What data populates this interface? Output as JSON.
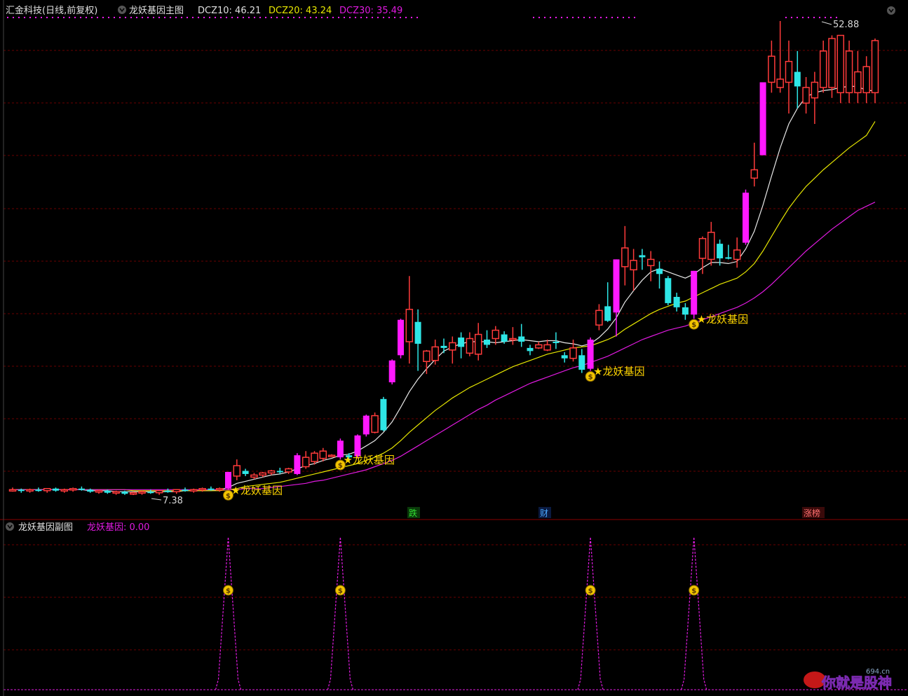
{
  "main_panel": {
    "title": "汇金科技(日线,前复权)",
    "indicator_name": "龙妖基因主图",
    "dcz10_label": "DCZ10: 46.21",
    "dcz20_label": "DCZ20: 43.24",
    "dcz30_label": "DCZ30: 35.49",
    "high_label": "52.88",
    "low_label": "7.38",
    "signal_label": "★龙妖基因",
    "event_tags": [
      "跌",
      "财",
      "涨榜"
    ]
  },
  "sub_panel": {
    "title": "龙妖基因副图",
    "value_label": "龙妖基因: 0.00"
  },
  "watermark": {
    "text": "你就是股神",
    "domain": "694.cn"
  },
  "colors": {
    "background": "#000000",
    "up": "#ff3b3b",
    "down": "#2ee6e6",
    "strong": "#ff19ff",
    "dcz10": "#e8e8e8",
    "dcz20": "#e6e600",
    "dcz30": "#e01ae0",
    "grid": "#6a0000",
    "signal_text": "#ffd500"
  },
  "chart_data": {
    "type": "candlestick",
    "ylim": [
      5,
      55
    ],
    "x": [
      0,
      1,
      2,
      3,
      4,
      5,
      6,
      7,
      8,
      9,
      10,
      11,
      12,
      13,
      14,
      15,
      16,
      17,
      18,
      19,
      20,
      21,
      22,
      23,
      24,
      25,
      26,
      27,
      28,
      29,
      30,
      31,
      32,
      33,
      34,
      35,
      36,
      37,
      38,
      39,
      40,
      41,
      42,
      43,
      44,
      45,
      46,
      47,
      48,
      49,
      50,
      51,
      52,
      53,
      54,
      55,
      56,
      57,
      58,
      59,
      60,
      61,
      62,
      63,
      64,
      65,
      66,
      67,
      68,
      69,
      70,
      71,
      72,
      73,
      74,
      75,
      76,
      77,
      78,
      79,
      80,
      81,
      82,
      83,
      84,
      85,
      86,
      87,
      88,
      89,
      90,
      91,
      92,
      93,
      94,
      95,
      96,
      97,
      98,
      99,
      100
    ],
    "candles": [
      [
        7.9,
        8.1,
        7.7,
        7.9,
        "u"
      ],
      [
        7.9,
        8.0,
        7.6,
        7.8,
        "d"
      ],
      [
        7.8,
        8.0,
        7.6,
        7.9,
        "u"
      ],
      [
        7.9,
        8.1,
        7.7,
        7.8,
        "d"
      ],
      [
        7.8,
        8.0,
        7.6,
        8.0,
        "u"
      ],
      [
        8.0,
        8.1,
        7.7,
        7.8,
        "d"
      ],
      [
        7.8,
        8.0,
        7.6,
        7.9,
        "u"
      ],
      [
        7.9,
        8.1,
        7.7,
        8.0,
        "u"
      ],
      [
        8.0,
        8.2,
        7.8,
        7.9,
        "d"
      ],
      [
        7.9,
        8.0,
        7.6,
        7.7,
        "d"
      ],
      [
        7.7,
        7.9,
        7.5,
        7.8,
        "u"
      ],
      [
        7.8,
        7.9,
        7.5,
        7.6,
        "d"
      ],
      [
        7.6,
        7.8,
        7.4,
        7.7,
        "u"
      ],
      [
        7.7,
        7.8,
        7.4,
        7.5,
        "d"
      ],
      [
        7.5,
        7.7,
        7.38,
        7.6,
        "u"
      ],
      [
        7.6,
        7.8,
        7.4,
        7.7,
        "u"
      ],
      [
        7.7,
        7.9,
        7.5,
        7.6,
        "d"
      ],
      [
        7.6,
        7.8,
        7.4,
        7.8,
        "u"
      ],
      [
        7.8,
        8.0,
        7.6,
        7.7,
        "d"
      ],
      [
        7.7,
        7.9,
        7.5,
        7.9,
        "u"
      ],
      [
        7.9,
        8.1,
        7.7,
        7.8,
        "d"
      ],
      [
        7.8,
        8.0,
        7.6,
        7.9,
        "u"
      ],
      [
        7.9,
        8.1,
        7.7,
        8.0,
        "u"
      ],
      [
        8.0,
        8.2,
        7.8,
        7.9,
        "d"
      ],
      [
        7.9,
        8.1,
        7.7,
        8.0,
        "u"
      ],
      [
        8.0,
        9.6,
        7.9,
        9.6,
        "s"
      ],
      [
        9.2,
        10.8,
        8.8,
        10.2,
        "u"
      ],
      [
        9.7,
        9.9,
        9.2,
        9.4,
        "d"
      ],
      [
        9.1,
        9.5,
        8.9,
        9.3,
        "u"
      ],
      [
        9.3,
        9.6,
        9.1,
        9.5,
        "u"
      ],
      [
        9.5,
        9.8,
        9.3,
        9.7,
        "u"
      ],
      [
        9.7,
        10.0,
        9.4,
        9.6,
        "d"
      ],
      [
        9.6,
        10.0,
        9.4,
        9.9,
        "u"
      ],
      [
        9.4,
        11.4,
        9.3,
        11.2,
        "s"
      ],
      [
        10.1,
        11.6,
        9.9,
        11.0,
        "u"
      ],
      [
        10.6,
        11.6,
        10.3,
        11.4,
        "u"
      ],
      [
        10.9,
        11.9,
        10.6,
        11.6,
        "u"
      ],
      [
        11.1,
        11.3,
        11.0,
        11.2,
        "u"
      ],
      [
        11.0,
        12.8,
        10.8,
        12.6,
        "s"
      ],
      [
        11.2,
        11.4,
        10.8,
        11.0,
        "d"
      ],
      [
        11.1,
        13.2,
        10.9,
        13.1,
        "s"
      ],
      [
        13.2,
        15.1,
        13.0,
        15.0,
        "s"
      ],
      [
        13.4,
        15.3,
        13.3,
        15.0,
        "u"
      ],
      [
        13.6,
        16.8,
        13.5,
        16.6,
        "d"
      ],
      [
        18.2,
        20.4,
        18.0,
        20.3,
        "s"
      ],
      [
        20.8,
        24.3,
        20.5,
        24.2,
        "s"
      ],
      [
        22.1,
        28.4,
        20.0,
        25.2,
        "u"
      ],
      [
        24.0,
        25.2,
        19.3,
        21.9,
        "d"
      ],
      [
        20.2,
        21.3,
        19.0,
        21.2,
        "u"
      ],
      [
        20.3,
        22.3,
        19.9,
        21.6,
        "u"
      ],
      [
        21.5,
        22.4,
        21.0,
        21.7,
        "d"
      ],
      [
        21.3,
        22.6,
        20.0,
        22.0,
        "u"
      ],
      [
        21.6,
        23.0,
        20.5,
        22.5,
        "d"
      ],
      [
        21.0,
        23.0,
        20.7,
        22.4,
        "u"
      ],
      [
        20.9,
        23.9,
        20.3,
        22.8,
        "u"
      ],
      [
        21.8,
        23.2,
        21.5,
        22.3,
        "d"
      ],
      [
        22.4,
        23.6,
        21.8,
        23.2,
        "u"
      ],
      [
        22.8,
        23.1,
        21.9,
        22.1,
        "d"
      ],
      [
        22.3,
        23.5,
        21.8,
        22.4,
        "u"
      ],
      [
        22.1,
        23.8,
        21.6,
        22.6,
        "d"
      ],
      [
        21.5,
        21.8,
        20.8,
        21.2,
        "d"
      ],
      [
        21.5,
        22.1,
        21.4,
        21.8,
        "u"
      ],
      [
        21.3,
        22.3,
        21.2,
        21.8,
        "u"
      ],
      [
        22.1,
        23.0,
        21.4,
        22.1,
        "d"
      ],
      [
        20.8,
        21.1,
        20.1,
        20.5,
        "d"
      ],
      [
        20.5,
        22.3,
        20.2,
        21.5,
        "u"
      ],
      [
        19.4,
        21.4,
        19.1,
        20.8,
        "d"
      ],
      [
        19.5,
        22.5,
        19.3,
        22.3,
        "s"
      ],
      [
        23.7,
        25.7,
        23.2,
        25.1,
        "u"
      ],
      [
        24.1,
        27.8,
        24.0,
        25.5,
        "d"
      ],
      [
        24.9,
        30.0,
        22.6,
        30.0,
        "s"
      ],
      [
        29.3,
        33.2,
        27.5,
        31.1,
        "u"
      ],
      [
        29.0,
        31.0,
        27.0,
        29.9,
        "u"
      ],
      [
        30.4,
        31.0,
        29.0,
        30.2,
        "d"
      ],
      [
        29.4,
        30.8,
        27.9,
        30.0,
        "u"
      ],
      [
        29.1,
        29.8,
        27.2,
        28.6,
        "d"
      ],
      [
        25.8,
        28.4,
        25.6,
        28.2,
        "d"
      ],
      [
        25.4,
        26.8,
        25.0,
        26.4,
        "d"
      ],
      [
        24.7,
        25.8,
        24.2,
        25.4,
        "d"
      ],
      [
        24.7,
        28.9,
        24.3,
        28.9,
        "s"
      ],
      [
        30.1,
        32.2,
        28.6,
        32.0,
        "u"
      ],
      [
        30.0,
        33.6,
        29.4,
        32.6,
        "u"
      ],
      [
        30.1,
        31.9,
        29.4,
        31.5,
        "d"
      ],
      [
        30.2,
        31.4,
        30.0,
        30.2,
        "d"
      ],
      [
        30.0,
        32.1,
        29.2,
        30.9,
        "u"
      ],
      [
        31.6,
        36.7,
        31.4,
        36.4,
        "s"
      ],
      [
        37.8,
        41.2,
        37.0,
        38.6,
        "u"
      ],
      [
        40.0,
        46.0,
        40.0,
        47.0,
        "s"
      ],
      [
        47.0,
        51.0,
        46.0,
        49.5,
        "u"
      ],
      [
        46.5,
        52.88,
        46.0,
        47.3,
        "u"
      ],
      [
        47.0,
        51.0,
        44.0,
        49.0,
        "u"
      ],
      [
        48.0,
        50.0,
        44.5,
        46.6,
        "d"
      ],
      [
        45.0,
        47.5,
        44.0,
        46.5,
        "u"
      ],
      [
        45.5,
        48.0,
        43.0,
        47.0,
        "u"
      ],
      [
        46.5,
        51.0,
        46.0,
        50.0,
        "u"
      ],
      [
        46.5,
        51.5,
        45.5,
        51.2,
        "u"
      ],
      [
        46.0,
        51.5,
        45.0,
        51.5,
        "u"
      ],
      [
        46.0,
        51.0,
        45.0,
        50.0,
        "u"
      ],
      [
        46.0,
        50.0,
        45.0,
        48.0,
        "u"
      ],
      [
        46.0,
        49.5,
        45.0,
        48.5,
        "u"
      ],
      [
        46.0,
        51.2,
        45.0,
        51.0,
        "u"
      ]
    ],
    "dcz10": [
      7.9,
      7.9,
      7.9,
      7.9,
      7.9,
      7.9,
      7.9,
      7.9,
      7.9,
      7.8,
      7.8,
      7.8,
      7.7,
      7.7,
      7.7,
      7.7,
      7.7,
      7.7,
      7.7,
      7.7,
      7.8,
      7.8,
      7.8,
      7.8,
      7.9,
      8.1,
      8.5,
      8.7,
      8.9,
      9.1,
      9.3,
      9.4,
      9.6,
      9.9,
      10.2,
      10.4,
      10.7,
      10.9,
      11.2,
      11.3,
      11.6,
      12.1,
      12.6,
      13.4,
      14.4,
      15.8,
      17.3,
      18.5,
      19.5,
      20.4,
      21.2,
      21.6,
      21.9,
      22.1,
      22.1,
      22.1,
      22.0,
      22.1,
      22.2,
      22.3,
      22.2,
      22.1,
      22.2,
      22.2,
      22.0,
      21.9,
      21.7,
      21.9,
      22.5,
      23.3,
      24.4,
      25.9,
      27.0,
      28.0,
      28.8,
      29.1,
      28.8,
      28.5,
      28.2,
      28.6,
      29.2,
      29.7,
      29.7,
      29.6,
      29.8,
      31.0,
      32.7,
      35.2,
      38.0,
      40.7,
      43.0,
      44.5,
      45.6,
      46.0,
      46.2,
      46.3,
      46.5,
      46.6,
      46.6,
      46.2,
      46.2
    ],
    "dcz20": [
      7.9,
      7.9,
      7.9,
      7.9,
      7.9,
      7.9,
      7.9,
      7.9,
      7.9,
      7.9,
      7.9,
      7.9,
      7.9,
      7.9,
      7.8,
      7.8,
      7.8,
      7.8,
      7.8,
      7.8,
      7.8,
      7.8,
      7.8,
      7.8,
      7.8,
      7.9,
      8.0,
      8.2,
      8.3,
      8.4,
      8.5,
      8.6,
      8.8,
      9.0,
      9.2,
      9.4,
      9.6,
      9.8,
      10.0,
      10.2,
      10.4,
      10.7,
      11.0,
      11.4,
      11.9,
      12.6,
      13.4,
      14.1,
      14.8,
      15.5,
      16.1,
      16.7,
      17.2,
      17.7,
      18.1,
      18.5,
      18.9,
      19.3,
      19.7,
      20.0,
      20.3,
      20.6,
      20.9,
      21.1,
      21.3,
      21.5,
      21.6,
      21.7,
      22.0,
      22.3,
      22.7,
      23.3,
      23.8,
      24.3,
      24.8,
      25.2,
      25.5,
      25.8,
      26.0,
      26.4,
      26.8,
      27.2,
      27.6,
      27.9,
      28.2,
      28.8,
      29.6,
      30.8,
      32.2,
      33.6,
      34.9,
      36.0,
      37.0,
      37.8,
      38.6,
      39.3,
      40.0,
      40.7,
      41.3,
      41.9,
      43.24
    ],
    "dcz30": [
      7.9,
      7.9,
      7.9,
      7.9,
      7.9,
      7.9,
      7.9,
      7.9,
      7.9,
      7.9,
      7.9,
      7.9,
      7.9,
      7.9,
      7.9,
      7.9,
      7.9,
      7.9,
      7.9,
      7.9,
      7.9,
      7.9,
      7.9,
      7.9,
      7.9,
      7.9,
      7.9,
      8.0,
      8.0,
      8.0,
      8.1,
      8.2,
      8.3,
      8.4,
      8.5,
      8.7,
      8.8,
      9.0,
      9.2,
      9.4,
      9.6,
      9.8,
      10.1,
      10.4,
      10.7,
      11.1,
      11.6,
      12.1,
      12.6,
      13.1,
      13.6,
      14.1,
      14.6,
      15.1,
      15.6,
      16.0,
      16.5,
      16.9,
      17.3,
      17.7,
      18.1,
      18.4,
      18.7,
      19.0,
      19.3,
      19.6,
      19.8,
      20.1,
      20.4,
      20.7,
      21.1,
      21.5,
      21.9,
      22.3,
      22.6,
      22.9,
      23.2,
      23.4,
      23.6,
      23.9,
      24.2,
      24.5,
      24.8,
      25.1,
      25.4,
      25.8,
      26.3,
      26.9,
      27.6,
      28.4,
      29.2,
      30.0,
      30.8,
      31.5,
      32.2,
      32.9,
      33.5,
      34.1,
      34.7,
      35.1,
      35.49
    ],
    "signals": [
      25,
      38,
      67,
      79
    ],
    "sub_series": {
      "name": "龙妖基因",
      "ylim": [
        0,
        1
      ],
      "peaks": [
        25,
        38,
        67,
        79
      ]
    }
  }
}
